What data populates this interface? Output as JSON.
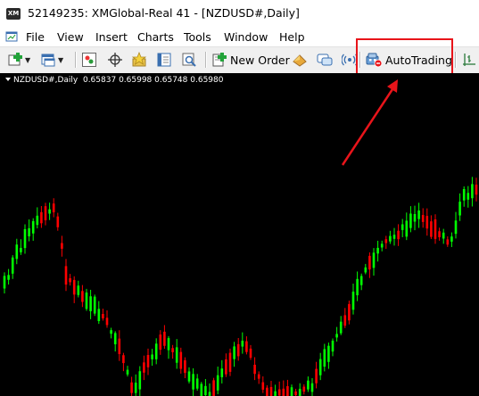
{
  "window": {
    "title": "52149235: XMGlobal-Real 41 - [NZDUSD#,Daily]",
    "logo_text": "XM"
  },
  "menu": {
    "items": [
      "File",
      "View",
      "Insert",
      "Charts",
      "Tools",
      "Window",
      "Help"
    ]
  },
  "toolbar": {
    "new_order_label": "New Order",
    "autotrading_label": "AutoTrading",
    "icons": [
      "new-chart-icon",
      "profiles-icon",
      "market-watch-icon",
      "crosshair-icon",
      "favorites-icon",
      "navigator-icon",
      "tester-icon",
      "new-order-icon",
      "metaeditor-icon",
      "signals-icon",
      "autotrading-icon",
      "period-icon"
    ]
  },
  "chart": {
    "symbol": "NZDUSD#,Daily",
    "open": "0.65837",
    "high": "0.65998",
    "low": "0.65748",
    "close": "0.65980",
    "colors": {
      "background": "#000000",
      "bull": "#00ff00",
      "bear": "#ff0000"
    }
  },
  "annotation": {
    "color": "#e8141a"
  }
}
